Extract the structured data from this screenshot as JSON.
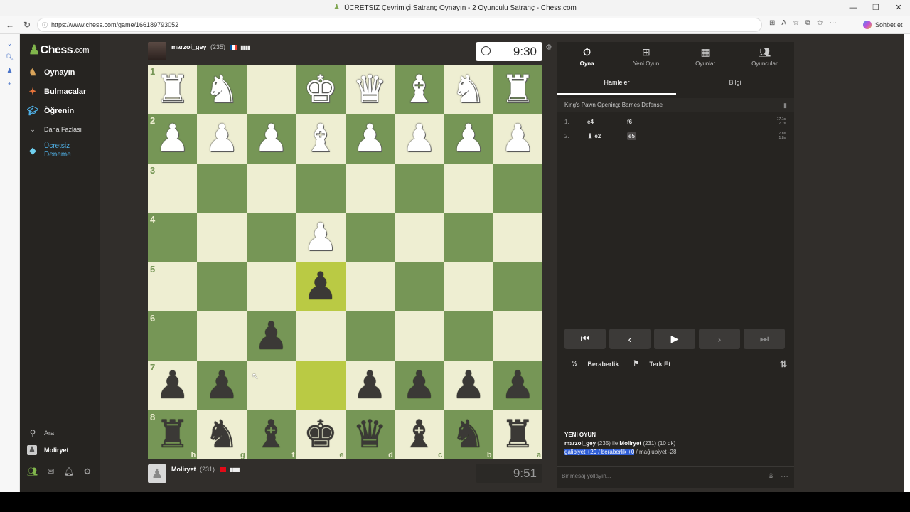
{
  "browser": {
    "title": "ÜCRETSİZ Çevrimiçi Satranç Oynayın - 2 Oyunculu Satranç - Chess.com",
    "url": "https://www.chess.com/game/166189793052",
    "copilot_label": "Sohbet et"
  },
  "sidebar": {
    "logo": "Chess",
    "logo_suffix": ".com",
    "items": [
      {
        "label": "Oynayın",
        "icon": "play-icon"
      },
      {
        "label": "Bulmacalar",
        "icon": "puzzle-icon"
      },
      {
        "label": "Öğrenin",
        "icon": "learn-icon"
      },
      {
        "label": "Daha Fazlası",
        "icon": "chevron-down-icon"
      },
      {
        "label_line1": "Ücretsiz",
        "label_line2": "Deneme",
        "icon": "diamond-icon"
      }
    ],
    "search_label": "Ara",
    "user_label": "Moliryet"
  },
  "top_player": {
    "name": "marzoi_gey",
    "rating": "(235)",
    "clock": "9:30"
  },
  "bottom_player": {
    "name": "Moliryet",
    "rating": "(231)",
    "clock": "9:51"
  },
  "board": {
    "ranks": [
      "1",
      "2",
      "3",
      "4",
      "5",
      "6",
      "7",
      "8"
    ],
    "files": [
      "h",
      "g",
      "f",
      "e",
      "d",
      "c",
      "b",
      "a"
    ],
    "rows": [
      [
        "wR",
        "wN",
        "",
        "wK",
        "wQ",
        "wB",
        "wN",
        "wR"
      ],
      [
        "wP",
        "wP",
        "wP",
        "wB",
        "wP",
        "wP",
        "wP",
        "wP"
      ],
      [
        "",
        "",
        "",
        "",
        "",
        "",
        "",
        ""
      ],
      [
        "",
        "",
        "",
        "wP",
        "",
        "",
        "",
        ""
      ],
      [
        "",
        "",
        "",
        "bP",
        "",
        "",
        "",
        ""
      ],
      [
        "",
        "",
        "bP",
        "",
        "",
        "",
        "",
        ""
      ],
      [
        "bP",
        "bP",
        "",
        "",
        "bP",
        "bP",
        "bP",
        "bP"
      ],
      [
        "bR",
        "bN",
        "bB",
        "bK",
        "bQ",
        "bB",
        "bN",
        "bR"
      ]
    ],
    "highlighted": [
      "4,3",
      "6,3"
    ]
  },
  "panel": {
    "tabs": [
      {
        "label": "Oyna",
        "icon": "stopwatch-icon"
      },
      {
        "label": "Yeni Oyun",
        "icon": "plus-icon"
      },
      {
        "label": "Oyunlar",
        "icon": "board-icon"
      },
      {
        "label": "Oyuncular",
        "icon": "users-icon"
      }
    ],
    "subtabs": [
      "Hamleler",
      "Bilgi"
    ],
    "opening": "King's Pawn Opening: Barnes Defense",
    "moves": [
      {
        "num": "1.",
        "white": "e4",
        "black": "f6",
        "t1": "17.1s",
        "t2": "7.1s"
      },
      {
        "num": "2.",
        "white": "e2",
        "black": "e5",
        "t1": "7.8s",
        "t2": "1.8s"
      }
    ],
    "draw_label": "Beraberlik",
    "resign_label": "Terk Et",
    "new_game": {
      "header": "YENİ OYUN",
      "p1": "marzoi_gey",
      "p1_rating": "(235) ile",
      "p2": "Moliryet",
      "p2_rating": "(231) (10 dk)",
      "stats_sel": "galibiyet +29 / beraberlik +0",
      "stats_rest": " / mağlubiyet -28"
    },
    "chat_placeholder": "Bir mesaj yollayın..."
  }
}
